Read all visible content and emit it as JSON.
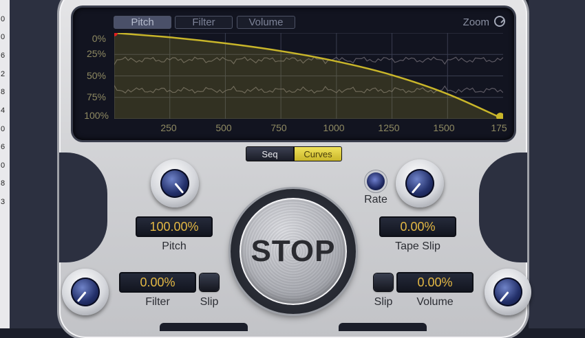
{
  "left_strip": {
    "digits": [
      "0",
      "0",
      "6",
      "2",
      "8",
      "4",
      "0",
      "6",
      "0",
      "8",
      "3"
    ]
  },
  "display": {
    "tabs": [
      {
        "label": "Pitch",
        "active": true
      },
      {
        "label": "Filter",
        "active": false
      },
      {
        "label": "Volume",
        "active": false
      }
    ],
    "zoom_label": "Zoom"
  },
  "chart_data": {
    "type": "line",
    "title": "",
    "xlabel": "",
    "ylabel": "",
    "x_ticks": [
      "250",
      "500",
      "750",
      "1000",
      "1250",
      "1500",
      "175"
    ],
    "y_ticks": [
      "0%",
      "25%",
      "50%",
      "75%",
      "100%"
    ],
    "xlim": [
      0,
      1750
    ],
    "ylim": [
      0,
      100
    ],
    "y_inverted": true,
    "grid": true,
    "series": [
      {
        "color": "#c9b62a",
        "x": [
          0,
          250,
          500,
          750,
          1000,
          1250,
          1500,
          1750
        ],
        "y": [
          0,
          5,
          12,
          21,
          33,
          49,
          71,
          100
        ]
      }
    ]
  },
  "mode_toggle": {
    "seq_label": "Seq",
    "curves_label": "Curves",
    "active": "Curves"
  },
  "controls": {
    "pitch": {
      "value": "100.00%",
      "label": "Pitch"
    },
    "rate": {
      "label": "Rate"
    },
    "tape_slip": {
      "value": "0.00%",
      "label": "Tape Slip"
    },
    "filter": {
      "value": "0.00%",
      "label": "Filter",
      "slip_label": "Slip"
    },
    "volume": {
      "value": "0.00%",
      "label": "Volume",
      "slip_label": "Slip"
    }
  },
  "stop_button": {
    "label": "STOP"
  },
  "colors": {
    "accent": "#e3b844",
    "curve": "#c9b62a",
    "panel": "#2c3040"
  }
}
